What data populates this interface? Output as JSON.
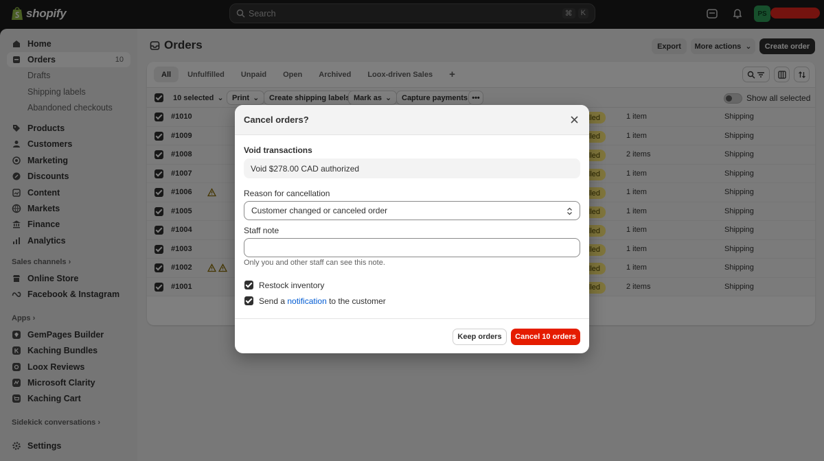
{
  "topbar": {
    "brand": "shopify",
    "search_placeholder": "Search",
    "shortcut_keys": [
      "⌘",
      "K"
    ],
    "avatar_initials": "PS"
  },
  "sidebar": {
    "nav": [
      {
        "label": "Home",
        "icon": "home-icon"
      },
      {
        "label": "Orders",
        "icon": "orders-icon",
        "count": "10",
        "active": true
      },
      {
        "label": "Drafts",
        "sub": true
      },
      {
        "label": "Shipping labels",
        "sub": true
      },
      {
        "label": "Abandoned checkouts",
        "sub": true
      },
      {
        "label": "Products",
        "icon": "tag-icon"
      },
      {
        "label": "Customers",
        "icon": "person-icon"
      },
      {
        "label": "Marketing",
        "icon": "target-icon"
      },
      {
        "label": "Discounts",
        "icon": "discount-icon"
      },
      {
        "label": "Content",
        "icon": "content-icon"
      },
      {
        "label": "Markets",
        "icon": "globe-icon"
      },
      {
        "label": "Finance",
        "icon": "bank-icon"
      },
      {
        "label": "Analytics",
        "icon": "chart-icon"
      }
    ],
    "sales_channels_title": "Sales channels",
    "sales_channels": [
      {
        "label": "Online Store",
        "icon": "store-icon"
      },
      {
        "label": "Facebook & Instagram",
        "icon": "meta-icon"
      }
    ],
    "apps_title": "Apps",
    "apps": [
      {
        "label": "GemPages Builder",
        "icon": "gem-icon"
      },
      {
        "label": "Kaching Bundles",
        "icon": "bundle-icon"
      },
      {
        "label": "Loox Reviews",
        "icon": "review-icon"
      },
      {
        "label": "Microsoft Clarity",
        "icon": "clarity-icon"
      },
      {
        "label": "Kaching Cart",
        "icon": "cart-icon"
      }
    ],
    "sidekick_title": "Sidekick conversations",
    "settings_label": "Settings"
  },
  "page": {
    "title": "Orders",
    "export_label": "Export",
    "more_actions_label": "More actions",
    "create_order_label": "Create order"
  },
  "tabs": [
    "All",
    "Unfulfilled",
    "Unpaid",
    "Open",
    "Archived",
    "Loox-driven Sales"
  ],
  "bulk": {
    "selected_label": "10 selected",
    "print_label": "Print",
    "shipping_labels_label": "Create shipping labels",
    "mark_as_label": "Mark as",
    "capture_label": "Capture payments",
    "show_all_label": "Show all selected"
  },
  "orders": [
    {
      "id": "#1010",
      "badge": "lled",
      "items": "1 item",
      "delivery": "Shipping"
    },
    {
      "id": "#1009",
      "badge": "lled",
      "items": "1 item",
      "delivery": "Shipping"
    },
    {
      "id": "#1008",
      "badge": "lled",
      "items": "2 items",
      "delivery": "Shipping"
    },
    {
      "id": "#1007",
      "badge": "lled",
      "items": "1 item",
      "delivery": "Shipping"
    },
    {
      "id": "#1006",
      "badge": "lled",
      "items": "1 item",
      "delivery": "Shipping",
      "warnings": 1
    },
    {
      "id": "#1005",
      "badge": "lled",
      "items": "1 item",
      "delivery": "Shipping"
    },
    {
      "id": "#1004",
      "badge": "lled",
      "items": "1 item",
      "delivery": "Shipping"
    },
    {
      "id": "#1003",
      "badge": "lled",
      "items": "1 item",
      "delivery": "Shipping"
    },
    {
      "id": "#1002",
      "badge": "lled",
      "items": "1 item",
      "delivery": "Shipping",
      "warnings": 2
    },
    {
      "id": "#1001",
      "badge": "lled",
      "items": "2 items",
      "delivery": "Shipping"
    }
  ],
  "modal": {
    "title": "Cancel orders?",
    "void_title": "Void transactions",
    "void_text": "Void $278.00 CAD authorized",
    "reason_label": "Reason for cancellation",
    "reason_value": "Customer changed or canceled order",
    "staff_note_label": "Staff note",
    "staff_note_value": "",
    "staff_note_help": "Only you and other staff can see this note.",
    "restock_label": "Restock inventory",
    "notify_prefix": "Send a ",
    "notify_link": "notification",
    "notify_suffix": " to the customer",
    "keep_label": "Keep orders",
    "cancel_label": "Cancel 10 orders"
  },
  "colors": {
    "critical": "#e51c00",
    "badge": "#ffeb78",
    "link": "#005bd3",
    "brand_green": "#95bf47"
  }
}
